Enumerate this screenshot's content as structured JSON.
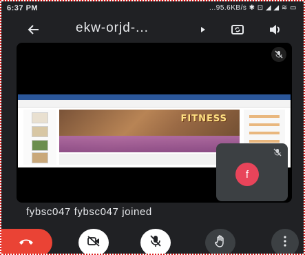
{
  "status_bar": {
    "time": "6:37 PM",
    "right": "...95.6KB/s ✱ ⊡ ◢ ◢ ≋ ▭"
  },
  "toolbar": {
    "meeting_code": "ekw-orjd-...",
    "icons": [
      "back-arrow-icon",
      "chevron-right-icon",
      "switch-camera-icon",
      "volume-icon"
    ]
  },
  "shared_slide": {
    "brand_text": "FITNESS"
  },
  "self_view": {
    "avatar_initial": "f",
    "avatar_color": "#e8445a"
  },
  "notification": {
    "text": "fybsc047 fybsc047 joined"
  },
  "controls": {
    "end_call_color": "#ea4335",
    "icons": [
      "end-call-icon",
      "camera-off-icon",
      "mic-off-icon",
      "raise-hand-icon",
      "more-options-icon"
    ]
  }
}
